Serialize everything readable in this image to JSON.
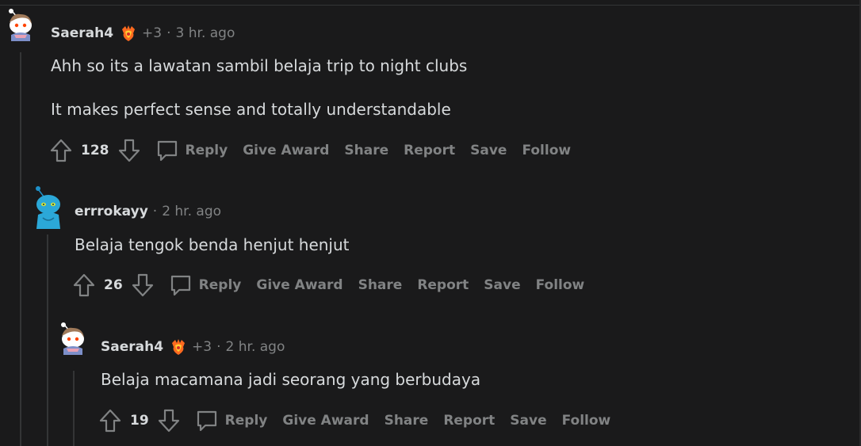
{
  "comments": [
    {
      "author": "Saerah4",
      "flair_icon": "flair-badge-icon",
      "extra_awards": "+3",
      "separator": "·",
      "time": "3 hr. ago",
      "paragraphs": [
        "Ahh so its a lawatan sambil belaja trip to night clubs",
        "It makes perfect sense and totally understandable"
      ],
      "score": "128"
    },
    {
      "author": "errrokayy",
      "separator": "·",
      "time": "2 hr. ago",
      "paragraphs": [
        "Belaja tengok benda henjut henjut"
      ],
      "score": "26"
    },
    {
      "author": "Saerah4",
      "flair_icon": "flair-badge-icon",
      "extra_awards": "+3",
      "separator": "·",
      "time": "2 hr. ago",
      "paragraphs": [
        "Belaja macamana jadi seorang yang berbudaya"
      ],
      "score": "19"
    }
  ],
  "actions": {
    "reply": "Reply",
    "give_award": "Give Award",
    "share": "Share",
    "report": "Report",
    "save": "Save",
    "follow": "Follow"
  },
  "colors": {
    "background": "#1a1a1b",
    "text": "#d7dadc",
    "muted": "#818384",
    "thread_line": "#343536"
  }
}
